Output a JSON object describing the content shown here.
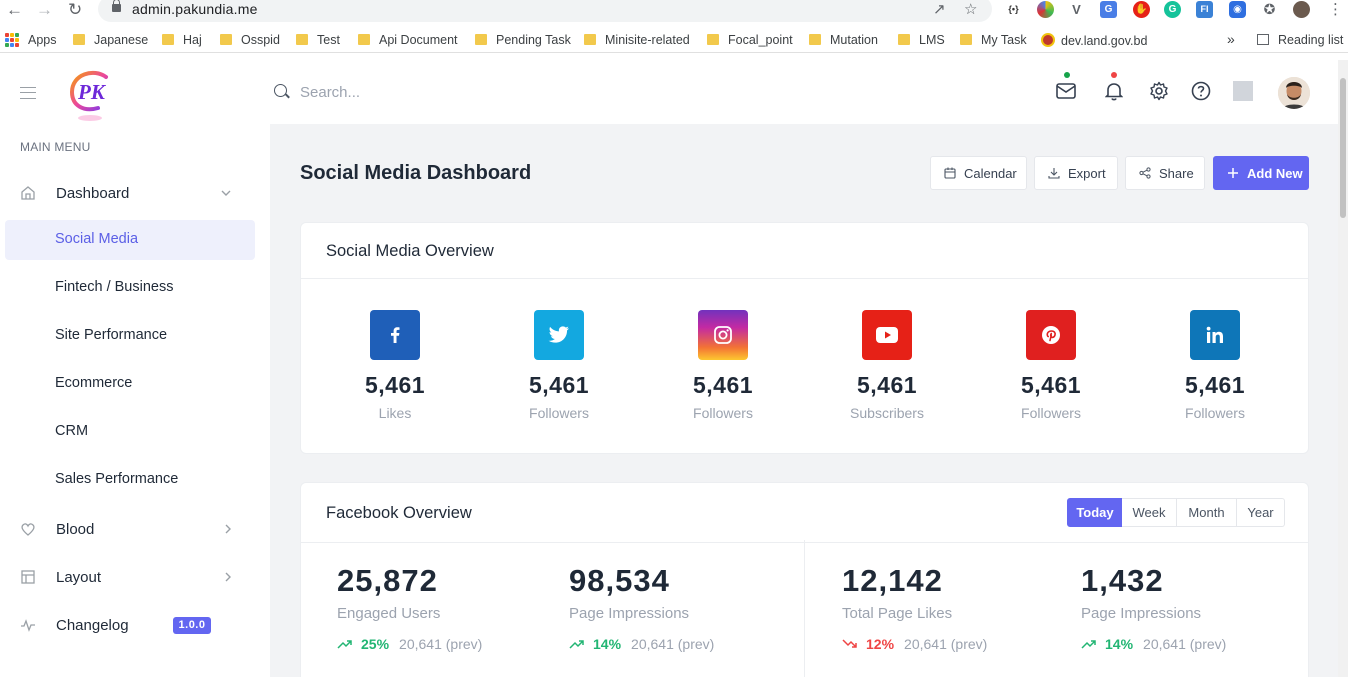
{
  "browser": {
    "url": "admin.pakundia.me",
    "bookmarks": [
      {
        "label": "Apps",
        "type": "apps"
      },
      {
        "label": "Japanese",
        "type": "folder"
      },
      {
        "label": "Haj",
        "type": "folder"
      },
      {
        "label": "Osspid",
        "type": "folder"
      },
      {
        "label": "Test",
        "type": "folder"
      },
      {
        "label": "Api Document",
        "type": "folder"
      },
      {
        "label": "Pending Task",
        "type": "folder"
      },
      {
        "label": "Minisite-related",
        "type": "folder"
      },
      {
        "label": "Focal_point",
        "type": "folder"
      },
      {
        "label": "Mutation",
        "type": "folder"
      },
      {
        "label": "LMS",
        "type": "folder"
      },
      {
        "label": "My Task",
        "type": "folder"
      },
      {
        "label": "dev.land.gov.bd",
        "type": "site"
      }
    ],
    "overflow_label": "»",
    "reading_list": "Reading list"
  },
  "header": {
    "search_placeholder": "Search...",
    "logo_letters": "PK"
  },
  "sidebar": {
    "menu_title": "MAIN MENU",
    "dashboard": "Dashboard",
    "sub_items": [
      "Social Media",
      "Fintech / Business",
      "Site Performance",
      "Ecommerce",
      "CRM",
      "Sales Performance"
    ],
    "active_sub": "Social Media",
    "blood": "Blood",
    "layout": "Layout",
    "changelog": "Changelog",
    "version": "1.0.0"
  },
  "page": {
    "title": "Social Media Dashboard",
    "actions": {
      "calendar": "Calendar",
      "export": "Export",
      "share": "Share",
      "add_new": "Add New"
    }
  },
  "overview": {
    "title": "Social Media Overview",
    "items": [
      {
        "network": "facebook",
        "value": "5,461",
        "label": "Likes",
        "color": "#1f5fb8"
      },
      {
        "network": "twitter",
        "value": "5,461",
        "label": "Followers",
        "color": "#13a8e0"
      },
      {
        "network": "instagram",
        "value": "5,461",
        "label": "Followers",
        "color": "#c32aa3"
      },
      {
        "network": "youtube",
        "value": "5,461",
        "label": "Subscribers",
        "color": "#e62117"
      },
      {
        "network": "pinterest",
        "value": "5,461",
        "label": "Followers",
        "color": "#e0201f"
      },
      {
        "network": "linkedin",
        "value": "5,461",
        "label": "Followers",
        "color": "#0e76b8"
      }
    ]
  },
  "facebook": {
    "title": "Facebook Overview",
    "periods": [
      "Today",
      "Week",
      "Month",
      "Year"
    ],
    "active_period": "Today",
    "stats": [
      {
        "value": "25,872",
        "label": "Engaged Users",
        "pct": "25%",
        "prev": "20,641 (prev)",
        "trend": "up"
      },
      {
        "value": "98,534",
        "label": "Page Impressions",
        "pct": "14%",
        "prev": "20,641 (prev)",
        "trend": "up"
      },
      {
        "value": "12,142",
        "label": "Total Page Likes",
        "pct": "12%",
        "prev": "20,641 (prev)",
        "trend": "down"
      },
      {
        "value": "1,432",
        "label": "Page Impressions",
        "pct": "14%",
        "prev": "20,641 (prev)",
        "trend": "up"
      }
    ]
  },
  "colors": {
    "accent": "#6366f1",
    "up": "#22b573",
    "down": "#ef4444"
  }
}
